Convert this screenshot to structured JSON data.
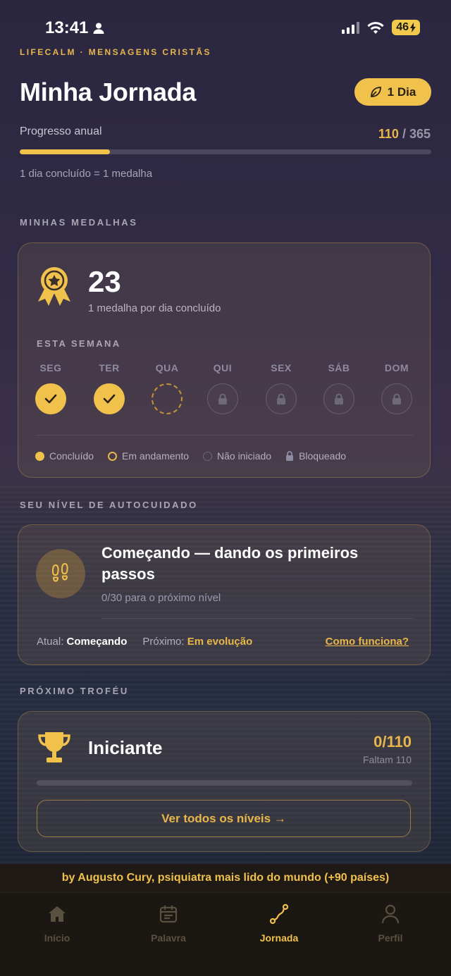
{
  "status_bar": {
    "time": "13:41",
    "battery": "46"
  },
  "brand": "LIFECALM · MENSAGENS CRISTÃS",
  "header": {
    "title": "Minha Jornada",
    "day_badge": "1 Dia"
  },
  "progress": {
    "label": "Progresso anual",
    "current": "110",
    "separator": " / ",
    "total": "365",
    "fraction": 0.22,
    "note": "1 dia concluído = 1 medalha"
  },
  "medals": {
    "section_label": "MINHAS MEDALHAS",
    "count": "23",
    "subtitle": "1 medalha por dia concluído",
    "week_label": "ESTA SEMANA",
    "days": [
      {
        "name": "SEG",
        "state": "done"
      },
      {
        "name": "TER",
        "state": "done"
      },
      {
        "name": "QUA",
        "state": "progress"
      },
      {
        "name": "QUI",
        "state": "locked"
      },
      {
        "name": "SEX",
        "state": "locked"
      },
      {
        "name": "SÁB",
        "state": "locked"
      },
      {
        "name": "DOM",
        "state": "locked"
      }
    ],
    "legend": {
      "done": "Concluído",
      "progress": "Em andamento",
      "not_started": "Não iniciado",
      "locked": "Bloqueado"
    }
  },
  "level": {
    "section_label": "SEU NÍVEL DE AUTOCUIDADO",
    "title": "Começando — dando os primeiros passos",
    "subtitle": "0/30 para o próximo nível",
    "current_label": "Atual:",
    "current_value": "Começando",
    "next_label": "Próximo:",
    "next_value": "Em evolução",
    "how_link": "Como funciona?"
  },
  "trophy": {
    "section_label": "PRÓXIMO TROFÉU",
    "name": "Iniciante",
    "count": "0/110",
    "remaining": "Faltam 110",
    "fraction": 0,
    "button": "Ver todos os níveis →"
  },
  "banner": "by Augusto Cury, psiquiatra mais lido do mundo (+90 países)",
  "tabs": [
    {
      "label": "Início",
      "icon": "home-icon"
    },
    {
      "label": "Palavra",
      "icon": "calendar-icon"
    },
    {
      "label": "Jornada",
      "icon": "journey-path-icon",
      "active": true
    },
    {
      "label": "Perfil",
      "icon": "person-icon"
    }
  ],
  "colors": {
    "accent": "#f0c14b",
    "accent_text": "#e9b64a"
  }
}
